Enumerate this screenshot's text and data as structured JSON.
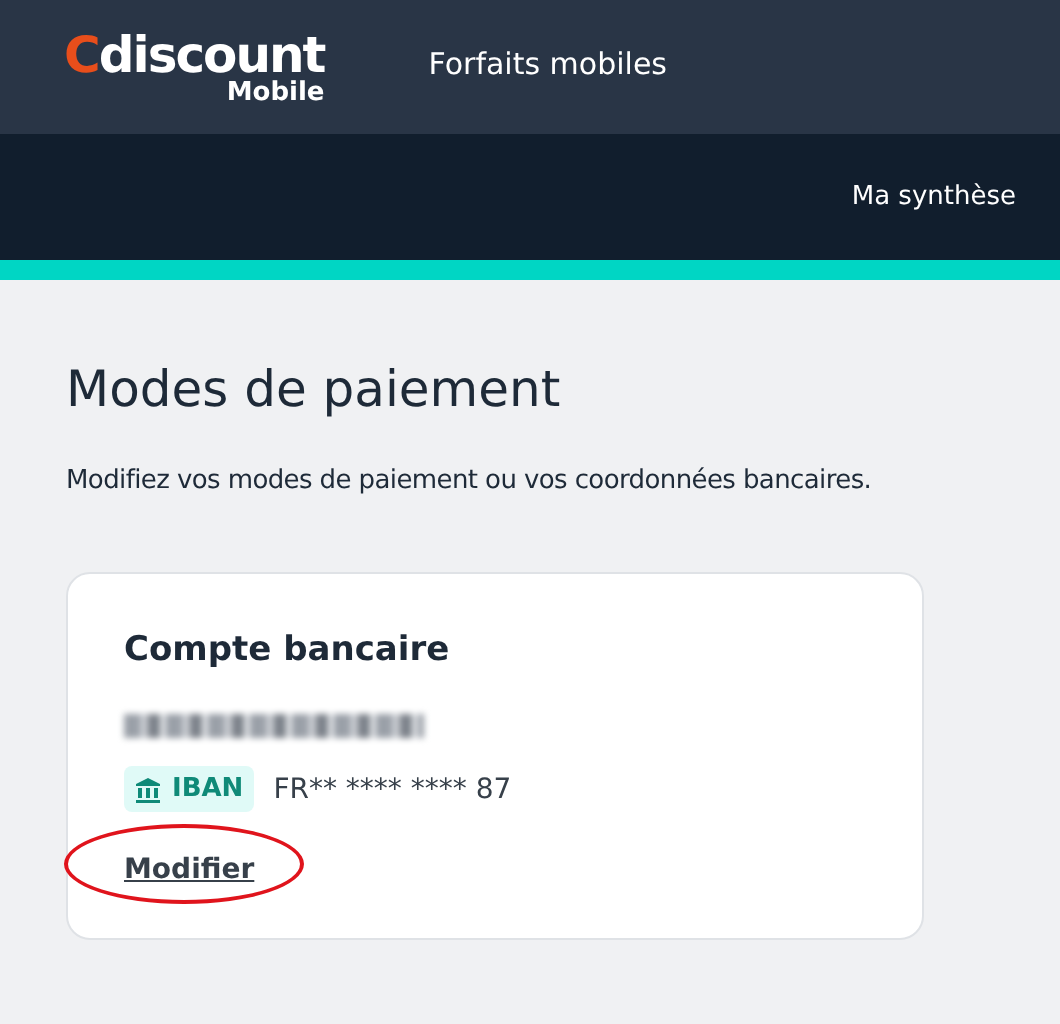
{
  "header": {
    "logo": {
      "brand": "Cdiscount",
      "sub": "Mobile"
    },
    "nav_link": "Forfaits mobiles"
  },
  "subnav": {
    "link": "Ma synthèse"
  },
  "page": {
    "title": "Modes de paiement",
    "description": "Modifiez vos modes de paiement ou vos coordonnées bancaires."
  },
  "card": {
    "title": "Compte bancaire",
    "holder_blurred": true,
    "badge": "IBAN",
    "iban": "FR** **** **** 87",
    "link": {
      "label": "Modifier",
      "highlighted": true
    }
  }
}
